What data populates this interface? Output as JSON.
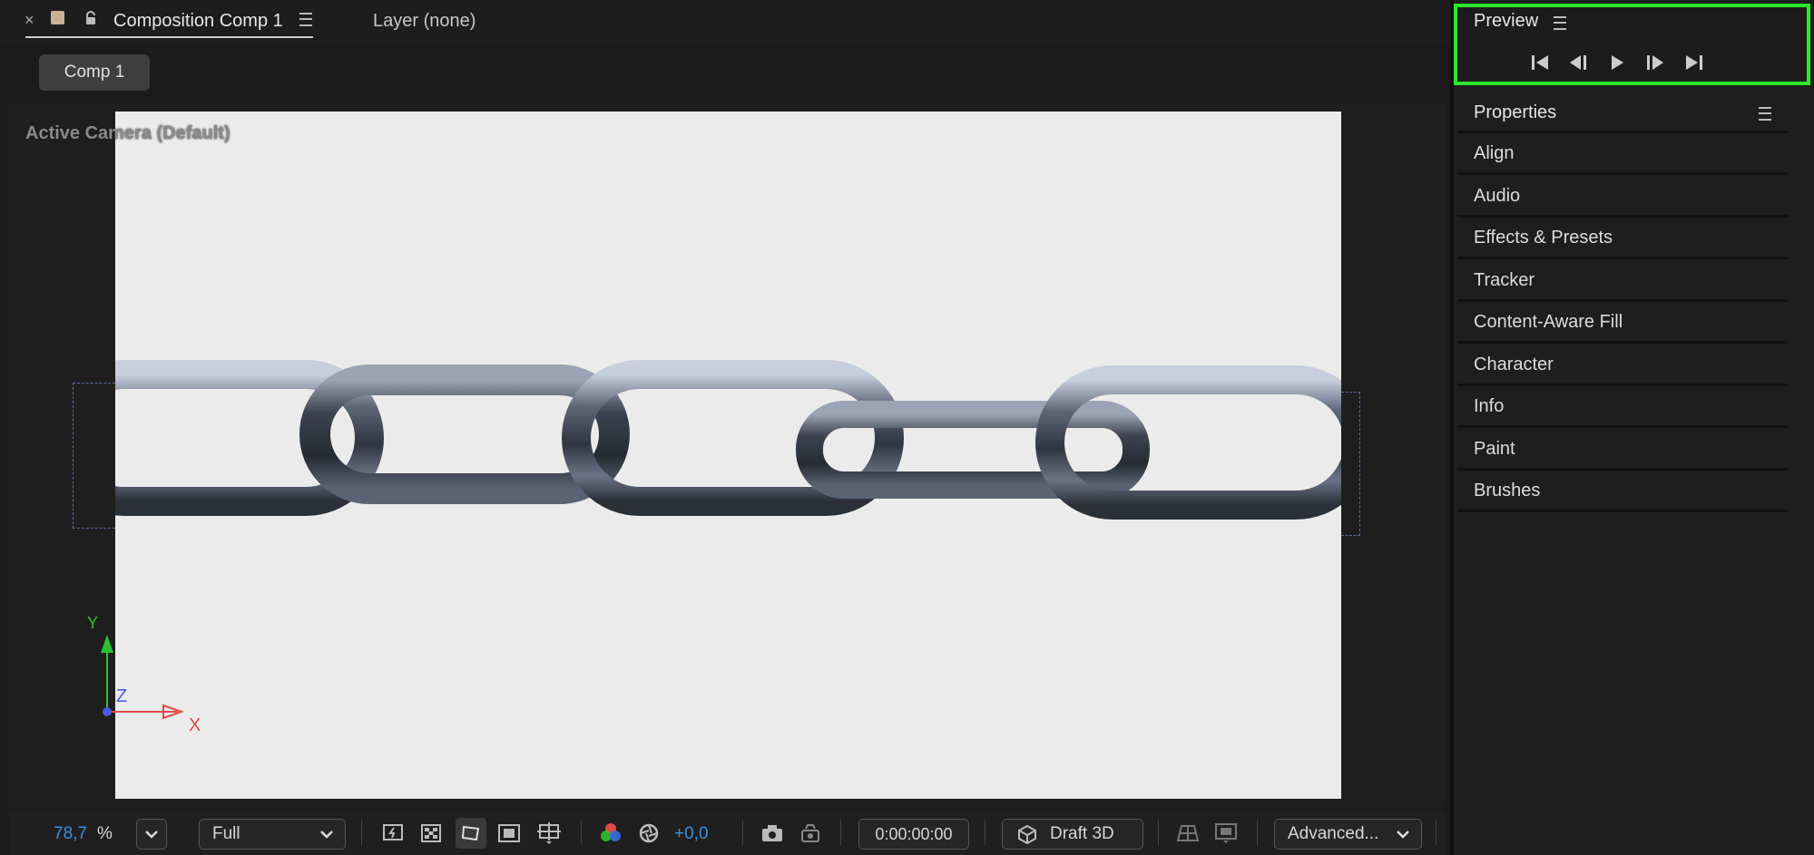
{
  "composition_panel": {
    "tab_close": "×",
    "tab_title": "Composition Comp 1",
    "layer_tab": "Layer (none)",
    "comp_chip": "Comp 1",
    "camera_label": "Active Camera (Default)",
    "axes": {
      "y": "Y",
      "z": "Z",
      "x": "X"
    }
  },
  "toolbar": {
    "zoom_value": "78,7",
    "zoom_unit": "%",
    "resolution": "Full",
    "exposure": "+0,0",
    "timecode": "0:00:00:00",
    "renderer": "Draft 3D",
    "view_mode": "Advanced..."
  },
  "preview": {
    "title": "Preview",
    "controls": [
      "first-frame-icon",
      "previous-frame-icon",
      "play-icon",
      "next-frame-icon",
      "last-frame-icon"
    ]
  },
  "properties": {
    "title": "Properties",
    "items": [
      "Align",
      "Audio",
      "Effects & Presets",
      "Tracker",
      "Content-Aware Fill",
      "Character",
      "Info",
      "Paint",
      "Brushes"
    ]
  },
  "colors": {
    "highlight": "#2ce62c",
    "accent_blue": "#3a8fe0",
    "axis_x": "#e04848",
    "axis_y": "#2ec02e",
    "axis_z": "#4a5ae0"
  }
}
